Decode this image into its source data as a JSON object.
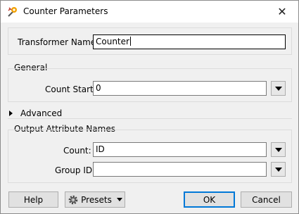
{
  "window": {
    "title": "Counter Parameters",
    "close_glyph": "✕"
  },
  "transformer_name": {
    "label": "Transformer Name:",
    "value": "Counter"
  },
  "general": {
    "title": "General",
    "count_start": {
      "label": "Count Start:",
      "value": "0"
    }
  },
  "advanced": {
    "label": "Advanced",
    "expanded": false
  },
  "output_attribute_names": {
    "title": "Output Attribute Names",
    "count": {
      "label": "Count:",
      "value": "ID"
    },
    "group_id": {
      "label": "Group ID:",
      "value": ""
    }
  },
  "buttons": {
    "help": "Help",
    "presets": "Presets",
    "ok": "OK",
    "cancel": "Cancel"
  },
  "icons": {
    "app": "fme-transformer-icon",
    "close": "close-icon",
    "dropdown": "chevron-down-icon",
    "expand": "triangle-right-icon",
    "presets": "gear-icon"
  },
  "colors": {
    "ok_border": "#0078d7"
  }
}
